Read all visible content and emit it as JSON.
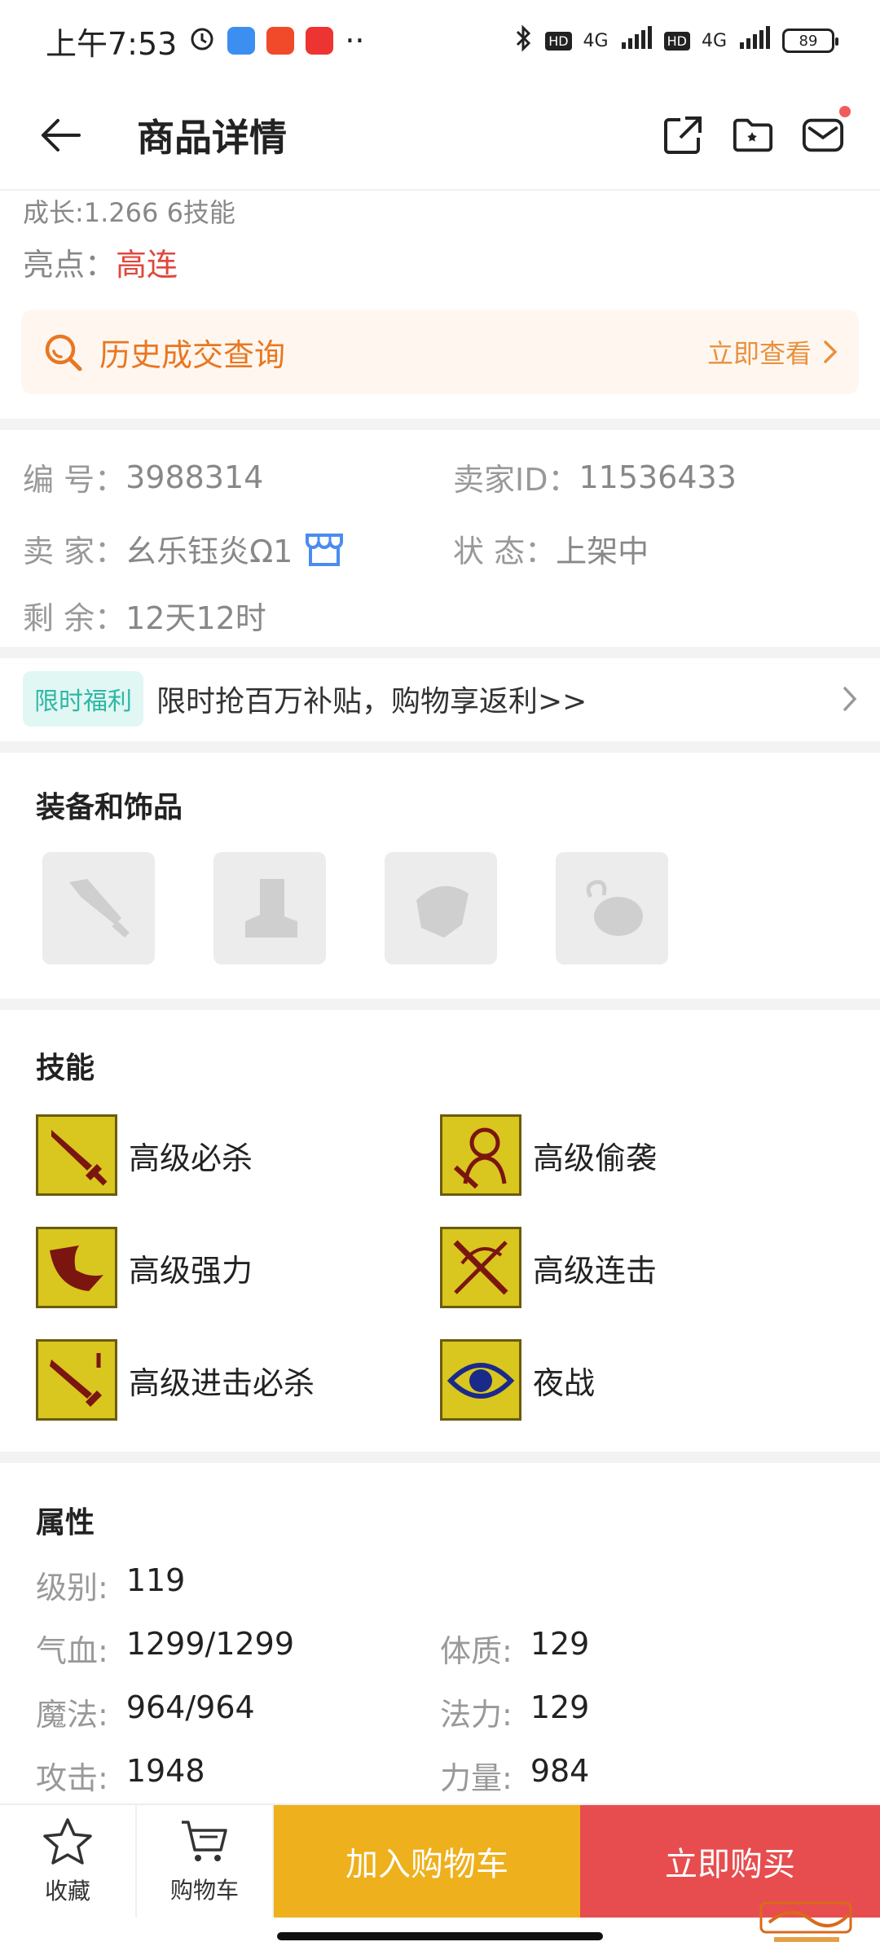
{
  "status_bar": {
    "time": "上午7:53",
    "battery": "89",
    "network_1": "4G",
    "network_2": "4G",
    "hd_1": "HD",
    "hd_2": "HD"
  },
  "nav": {
    "title": "商品详情"
  },
  "summary": {
    "growth_line": "成长:1.266 6技能",
    "highlight_label": "亮点：",
    "highlight_value": "高连"
  },
  "history": {
    "label": "历史成交查询",
    "action": "立即查看"
  },
  "info": {
    "number_label": "编  号：",
    "number_value": "3988314",
    "seller_id_label": "卖家ID：",
    "seller_id_value": "11536433",
    "seller_label": "卖  家：",
    "seller_value": "幺乐钰炎Ω1",
    "status_label": "状  态：",
    "status_value": "上架中",
    "remaining_label": "剩  余：",
    "remaining_value": "12天12时"
  },
  "benefit": {
    "tag": "限时福利",
    "text": "限时抢百万补贴，购物享返利>>"
  },
  "equipment": {
    "title": "装备和饰品",
    "slots": [
      "weapon-icon",
      "boots-icon",
      "armor-icon",
      "accessory-icon"
    ]
  },
  "skills": {
    "title": "技能",
    "items": [
      {
        "name": "高级必杀",
        "icon": "sword-icon"
      },
      {
        "name": "高级偷袭",
        "icon": "figure-icon"
      },
      {
        "name": "高级强力",
        "icon": "arm-icon"
      },
      {
        "name": "高级连击",
        "icon": "crossed-swords-icon"
      },
      {
        "name": "高级进击必杀",
        "icon": "sword-icon"
      },
      {
        "name": "夜战",
        "icon": "eye-icon"
      }
    ]
  },
  "attributes": {
    "title": "属性",
    "level_label": "级别:",
    "level_value": "119",
    "hp_label": "气血:",
    "hp_value": "1299/1299",
    "constitution_label": "体质:",
    "constitution_value": "129",
    "mp_label": "魔法:",
    "mp_value": "964/964",
    "magic_label": "法力:",
    "magic_value": "129",
    "attack_label": "攻击:",
    "attack_value": "1948",
    "strength_label": "力量:",
    "strength_value": "984"
  },
  "bottom_bar": {
    "favorite": "收藏",
    "cart": "购物车",
    "add_to_cart": "加入购物车",
    "buy_now": "立即购买"
  },
  "colors": {
    "accent_orange": "#e87722",
    "cart_button": "#eeb01c",
    "buy_button": "#e74d4f",
    "highlight_red": "#e0473c"
  }
}
